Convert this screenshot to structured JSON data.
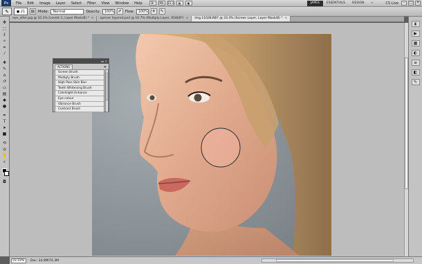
{
  "menubar": {
    "logo": "Ps",
    "items": [
      "File",
      "Edit",
      "Image",
      "Layer",
      "Select",
      "Filter",
      "View",
      "Window",
      "Help"
    ],
    "zoom_readout": "33.3",
    "workspaces": [
      "JAPES",
      "ESSENTIALS",
      "DESIGN"
    ],
    "workspace_more": "»",
    "cslive": "CS Live"
  },
  "options": {
    "mode_label": "Mode:",
    "mode_value": "Normal",
    "opacity_label": "Opacity:",
    "opacity_value": "100%",
    "flow_label": "Flow:",
    "flow_value": "100%"
  },
  "tabs": [
    {
      "label": "eye_after.jpg @ 33.3% (Levels 1, Layer Mask/8) *"
    },
    {
      "label": "opener layered.psd @ 16.7% (Multiply Layer, RGB/8*)"
    },
    {
      "label": "Img.11028.NEF @ 33.3% (Screen Layer, Layer Mask/8) *"
    }
  ],
  "actions_panel": {
    "tab": "ACTIONS",
    "items": [
      "Screen Brush",
      "Multiply Brush",
      "High Pass Skin Blur",
      "Teeth Whitening Brush",
      "Catchlight Enhance",
      "Eye colour",
      "Vibrance Brush",
      "Contrast Brush"
    ]
  },
  "status": {
    "zoom": "33.33%",
    "doc": "Doc: 34.9M/74.3M"
  },
  "colors": {
    "ui_gray": "#c4c4c4",
    "canvas_bg": "#bdbdbd",
    "active_workspace": "#2d2d2d"
  }
}
